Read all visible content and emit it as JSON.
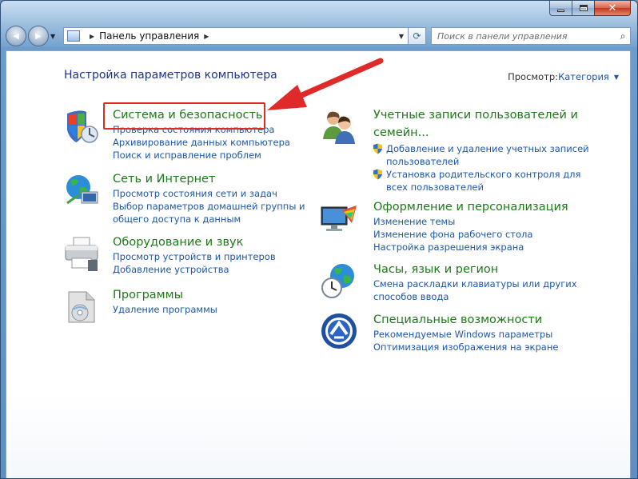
{
  "window": {
    "caption": {
      "minimize": "",
      "maximize": "",
      "close": "✕"
    }
  },
  "nav": {
    "back": "◀",
    "forward": "▶",
    "drop": "▼",
    "breadcrumb": "Панель управления",
    "addr_sep": "▶",
    "addr_sep2": "▶",
    "addr_drop": "▼",
    "refresh": "⟳"
  },
  "search": {
    "placeholder": "Поиск в панели управления",
    "icon": "⌕"
  },
  "content": {
    "title": "Настройка параметров компьютера",
    "view_by_label": "Просмотр:",
    "view_by_value": "Категория"
  },
  "left_categories": [
    {
      "title": "Система и безопасность",
      "links": [
        "Проверка состояния компьютера",
        "Архивирование данных компьютера",
        "Поиск и исправление проблем"
      ]
    },
    {
      "title": "Сеть и Интернет",
      "links": [
        "Просмотр состояния сети и задач",
        "Выбор параметров домашней группы и",
        "общего доступа к данным"
      ]
    },
    {
      "title": "Оборудование и звук",
      "links": [
        "Просмотр устройств и принтеров",
        "Добавление устройства"
      ]
    },
    {
      "title": "Программы",
      "links": [
        "Удаление программы"
      ]
    }
  ],
  "right_categories": [
    {
      "title_line1": "Учетные записи пользователей и",
      "title_line2": "семейн...",
      "links": [
        "Добавление и удаление учетных записей",
        "пользователей",
        "Установка родительского контроля для",
        "всех пользователей"
      ]
    },
    {
      "title": "Оформление и персонализация",
      "links": [
        "Изменение темы",
        "Изменение фона рабочего стола",
        "Настройка разрешения экрана"
      ]
    },
    {
      "title": "Часы, язык и регион",
      "links": [
        "Смена раскладки клавиатуры или других",
        "способов ввода"
      ]
    },
    {
      "title": "Специальные возможности",
      "links": [
        "Рекомендуемые Windows параметры",
        "Оптимизация изображения на экране"
      ]
    }
  ],
  "colors": {
    "link": "#1e57a8",
    "category": "#1d7a18",
    "title": "#1e3287",
    "annotation": "#e02a2a"
  }
}
